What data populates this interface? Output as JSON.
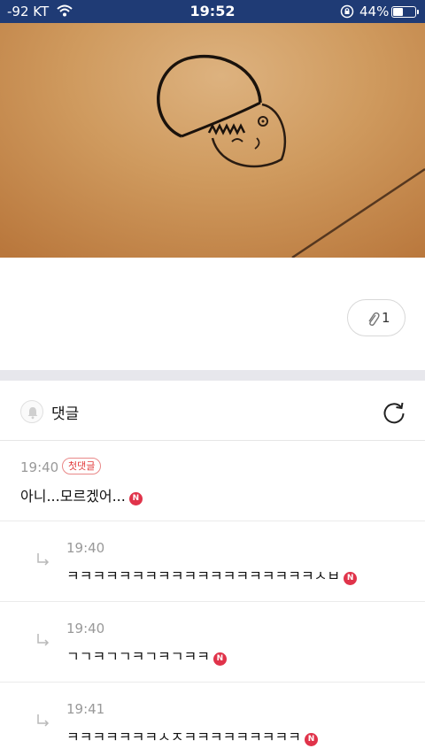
{
  "status_bar": {
    "carrier": "-92 KT",
    "time": "19:52",
    "battery_percent": "44%",
    "battery_level": 0.44,
    "text_color": "#ffffff",
    "background": "#1f3b75"
  },
  "photo": {
    "description_icon": "photo-attachment"
  },
  "attachment": {
    "icon": "paperclip-icon",
    "count": "1"
  },
  "comments": {
    "bell_icon": "bell-icon",
    "title": "댓글",
    "refresh_icon": "refresh-icon",
    "items": [
      {
        "time": "19:40",
        "badge": "첫댓글",
        "text": "아니...모르겠어...",
        "new": "N",
        "reply": false
      },
      {
        "time": "19:40",
        "text": "ㅋㅋㅋㅋㅋㅋㅋㅋㅋㅋㅋㅋㅋㅋㅋㅋㅋㅋㅋㅅㅂ",
        "new": "N",
        "reply": true
      },
      {
        "time": "19:40",
        "text": "ㄱㄱㅋㄱㄱㅋㄱㅋㄱㅋㅋ",
        "new": "N",
        "reply": true
      },
      {
        "time": "19:41",
        "text": "ㅋㅋㅋㅋㅋㅋㅋㅅㅈㅋㅋㅋㅋㅋㅋㅋㅋㅋ",
        "new": "N",
        "reply": true
      }
    ]
  },
  "colors": {
    "new_badge": "#e0334a",
    "first_badge": "#e23a3a",
    "divider": "#e7e7ec"
  }
}
